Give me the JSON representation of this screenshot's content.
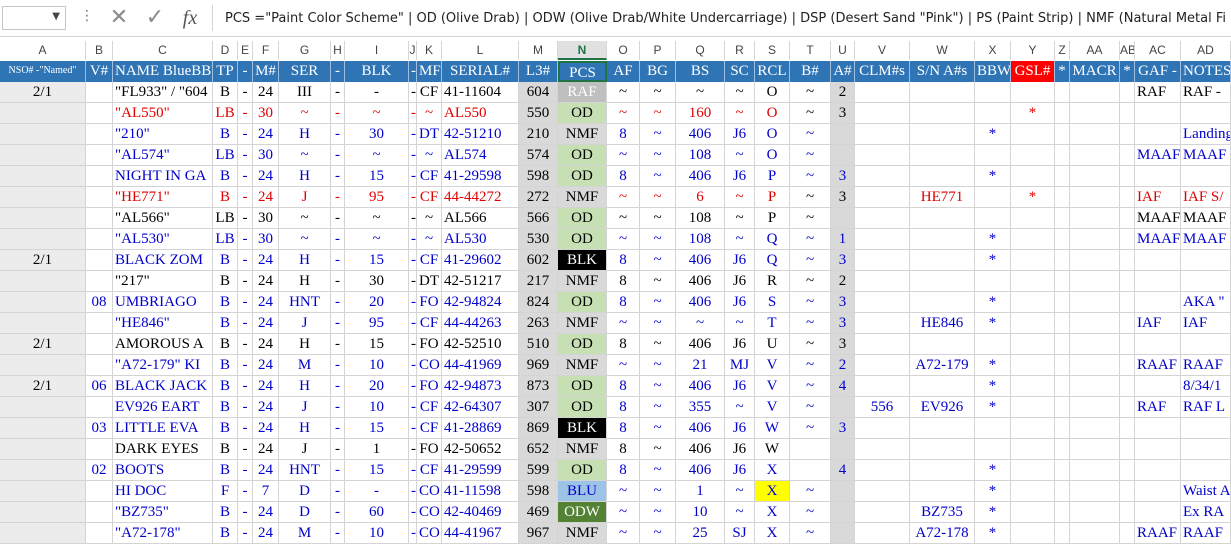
{
  "formula_bar": {
    "name_box": "",
    "fx_label": "fx",
    "formula": "PCS  =\"Paint Color Scheme\" | OD (Olive Drab) | ODW (Olive Drab/White Undercarriage) | DSP (Desert Sand \"Pink\") | PS (Paint Strip) | NMF (Natural Metal Finish)"
  },
  "column_letters": [
    "A",
    "B",
    "C",
    "D",
    "E",
    "F",
    "G",
    "H",
    "I",
    "J",
    "K",
    "L",
    "M",
    "N",
    "O",
    "P",
    "Q",
    "R",
    "S",
    "T",
    "U",
    "V",
    "W",
    "X",
    "Y",
    "Z",
    "AA",
    "AB",
    "AC",
    "AD"
  ],
  "header_row": [
    "NSO# -\"Named\"",
    "V#",
    "NAME BlueBBW",
    "TP",
    "-",
    "M#",
    "SER",
    "-",
    "BLK",
    "-",
    "MF",
    "SERIAL#",
    "L3#",
    "PCS",
    "AF",
    "BG",
    "BS",
    "SC",
    "RCL",
    "B#",
    "A#",
    "CLM#s",
    "S/N A#s",
    "BBW",
    "GSL#",
    "*",
    "MACR",
    "*",
    "GAF -",
    "NOTES"
  ],
  "rows": [
    [
      "2/1",
      "",
      "\"FL933\" / \"604",
      "B",
      "-",
      "24",
      "III",
      "-",
      "-",
      "-",
      "CF",
      "41-11604",
      "604",
      "RAF",
      "~",
      "~",
      "~",
      "~",
      "O",
      "~",
      "2",
      "",
      "",
      "",
      "",
      "",
      "",
      "",
      "RAF",
      "RAF -"
    ],
    [
      "",
      "",
      "\"AL550\"",
      "LB",
      "-",
      "30",
      "~",
      "-",
      "~",
      "-",
      "~",
      "AL550",
      "550",
      "OD",
      "~",
      "~",
      "160",
      "~",
      "O",
      "~",
      "3",
      "",
      "",
      "",
      "*",
      "",
      "",
      "",
      "",
      ""
    ],
    [
      "",
      "",
      "\"210\"",
      "B",
      "-",
      "24",
      "H",
      "-",
      "30",
      "-",
      "DT",
      "42-51210",
      "210",
      "NMF",
      "8",
      "~",
      "406",
      "J6",
      "O",
      "~",
      "",
      "",
      "",
      "*",
      "",
      "",
      "",
      "",
      "",
      "Landing"
    ],
    [
      "",
      "",
      "\"AL574\"",
      "LB",
      "-",
      "30",
      "~",
      "-",
      "~",
      "-",
      "~",
      "AL574",
      "574",
      "OD",
      "~",
      "~",
      "108",
      "~",
      "O",
      "~",
      "",
      "",
      "",
      "",
      "",
      "",
      "",
      "",
      "MAAF",
      "MAAF"
    ],
    [
      "",
      "",
      "NIGHT IN GA",
      "B",
      "-",
      "24",
      "H",
      "-",
      "15",
      "-",
      "CF",
      "41-29598",
      "598",
      "OD",
      "8",
      "~",
      "406",
      "J6",
      "P",
      "~",
      "3",
      "",
      "",
      "*",
      "",
      "",
      "",
      "",
      "",
      ""
    ],
    [
      "",
      "",
      "\"HE771\"",
      "B",
      "-",
      "24",
      "J",
      "-",
      "95",
      "-",
      "CF",
      "44-44272",
      "272",
      "NMF",
      "~",
      "~",
      "6",
      "~",
      "P",
      "~",
      "3",
      "",
      "HE771",
      "",
      "*",
      "",
      "",
      "",
      "IAF",
      "IAF S/"
    ],
    [
      "",
      "",
      "\"AL566\"",
      "LB",
      "-",
      "30",
      "~",
      "-",
      "~",
      "-",
      "~",
      "AL566",
      "566",
      "OD",
      "~",
      "~",
      "108",
      "~",
      "P",
      "~",
      "",
      "",
      "",
      "",
      "",
      "",
      "",
      "",
      "MAAF",
      "MAAF"
    ],
    [
      "",
      "",
      "\"AL530\"",
      "LB",
      "-",
      "30",
      "~",
      "-",
      "~",
      "-",
      "~",
      "AL530",
      "530",
      "OD",
      "~",
      "~",
      "108",
      "~",
      "Q",
      "~",
      "1",
      "",
      "",
      "*",
      "",
      "",
      "",
      "",
      "MAAF",
      "MAAF"
    ],
    [
      "2/1",
      "",
      "BLACK ZOM",
      "B",
      "-",
      "24",
      "H",
      "-",
      "15",
      "-",
      "CF",
      "41-29602",
      "602",
      "BLK",
      "8",
      "~",
      "406",
      "J6",
      "Q",
      "~",
      "3",
      "",
      "",
      "*",
      "",
      "",
      "",
      "",
      "",
      ""
    ],
    [
      "",
      "",
      "\"217\"",
      "B",
      "-",
      "24",
      "H",
      "-",
      "30",
      "-",
      "DT",
      "42-51217",
      "217",
      "NMF",
      "8",
      "~",
      "406",
      "J6",
      "R",
      "~",
      "2",
      "",
      "",
      "",
      "",
      "",
      "",
      "",
      "",
      ""
    ],
    [
      "",
      "08",
      "UMBRIAGO",
      "B",
      "-",
      "24",
      "HNT",
      "-",
      "20",
      "-",
      "FO",
      "42-94824",
      "824",
      "OD",
      "8",
      "~",
      "406",
      "J6",
      "S",
      "~",
      "3",
      "",
      "",
      "*",
      "",
      "",
      "",
      "",
      "",
      "AKA \""
    ],
    [
      "",
      "",
      "\"HE846\"",
      "B",
      "-",
      "24",
      "J",
      "-",
      "95",
      "-",
      "CF",
      "44-44263",
      "263",
      "NMF",
      "~",
      "~",
      "~",
      "~",
      "T",
      "~",
      "3",
      "",
      "HE846",
      "*",
      "",
      "",
      "",
      "",
      "IAF",
      "IAF"
    ],
    [
      "2/1",
      "",
      "AMOROUS A",
      "B",
      "-",
      "24",
      "H",
      "-",
      "15",
      "-",
      "FO",
      "42-52510",
      "510",
      "OD",
      "8",
      "~",
      "406",
      "J6",
      "U",
      "~",
      "3",
      "",
      "",
      "",
      "",
      "",
      "",
      "",
      "",
      ""
    ],
    [
      "",
      "",
      "\"A72-179\" KI",
      "B",
      "-",
      "24",
      "M",
      "-",
      "10",
      "-",
      "CO",
      "44-41969",
      "969",
      "NMF",
      "~",
      "~",
      "21",
      "MJ",
      "V",
      "~",
      "2",
      "",
      "A72-179",
      "*",
      "",
      "",
      "",
      "",
      "RAAF",
      "RAAF"
    ],
    [
      "2/1",
      "06",
      "BLACK JACK",
      "B",
      "-",
      "24",
      "H",
      "-",
      "20",
      "-",
      "FO",
      "42-94873",
      "873",
      "OD",
      "8",
      "~",
      "406",
      "J6",
      "V",
      "~",
      "4",
      "",
      "",
      "*",
      "",
      "",
      "",
      "",
      "",
      "8/34/1"
    ],
    [
      "",
      "",
      "EV926 EART",
      "B",
      "-",
      "24",
      "J",
      "-",
      "10",
      "-",
      "CF",
      "42-64307",
      "307",
      "OD",
      "8",
      "~",
      "355",
      "~",
      "V",
      "~",
      "",
      "556",
      "EV926",
      "*",
      "",
      "",
      "",
      "",
      "RAF",
      "RAF L"
    ],
    [
      "",
      "03",
      "LITTLE EVA",
      "B",
      "-",
      "24",
      "H",
      "-",
      "15",
      "-",
      "CF",
      "41-28869",
      "869",
      "BLK",
      "8",
      "~",
      "406",
      "J6",
      "W",
      "~",
      "3",
      "",
      "",
      "",
      "",
      "",
      "",
      "",
      "",
      ""
    ],
    [
      "",
      "",
      "DARK EYES",
      "B",
      "-",
      "24",
      "J",
      "-",
      "1",
      "-",
      "FO",
      "42-50652",
      "652",
      "NMF",
      "8",
      "~",
      "406",
      "J6",
      "W",
      "",
      "",
      "",
      "",
      "",
      "",
      "",
      "",
      "",
      "",
      ""
    ],
    [
      "",
      "02",
      "BOOTS",
      "B",
      "-",
      "24",
      "HNT",
      "-",
      "15",
      "-",
      "CF",
      "41-29599",
      "599",
      "OD",
      "8",
      "~",
      "406",
      "J6",
      "X",
      "",
      "4",
      "",
      "",
      "*",
      "",
      "",
      "",
      "",
      "",
      ""
    ],
    [
      "",
      "",
      "HI DOC",
      "F",
      "-",
      "7",
      "D",
      "-",
      "-",
      "-",
      "CO",
      "41-11598",
      "598",
      "BLU",
      "~",
      "~",
      "1",
      "~",
      "X",
      "~",
      "",
      "",
      "",
      "*",
      "",
      "",
      "",
      "",
      "",
      "Waist A"
    ],
    [
      "",
      "",
      "\"BZ735\"",
      "B",
      "-",
      "24",
      "D",
      "-",
      "60",
      "-",
      "CO",
      "42-40469",
      "469",
      "ODW",
      "~",
      "~",
      "10",
      "~",
      "X",
      "~",
      "",
      "",
      "BZ735",
      "*",
      "",
      "",
      "",
      "",
      "",
      "Ex RA"
    ],
    [
      "",
      "",
      "\"A72-178\"",
      "B",
      "-",
      "24",
      "M",
      "-",
      "10",
      "-",
      "CO",
      "44-41967",
      "967",
      "NMF",
      "~",
      "~",
      "25",
      "SJ",
      "X",
      "~",
      "",
      "",
      "A72-178",
      "*",
      "",
      "",
      "",
      "",
      "RAAF",
      "RAAF"
    ]
  ],
  "colors": {
    "header_bg": "#2f75b5",
    "red_text": "#e00000",
    "blue_text": "#0000cc",
    "od_fill": "#c6e0b4",
    "blk_fill": "#000000",
    "odw_fill": "#548235",
    "blu_fill": "#9dc3e6",
    "highlight_yellow": "#ffff00",
    "gsl_header": "#ff0000"
  },
  "selected_column": "N"
}
